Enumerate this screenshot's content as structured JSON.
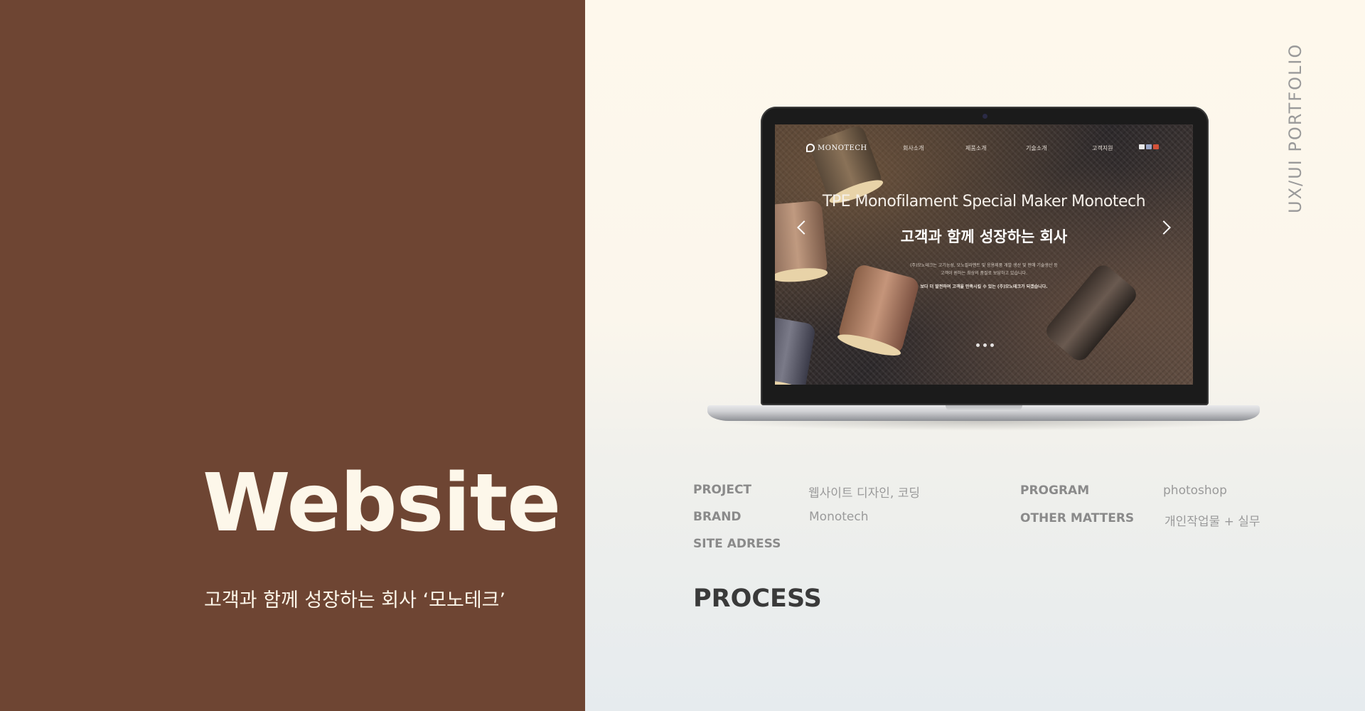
{
  "hero": {
    "title": "Website",
    "subtitle": "고객과 함께 성장하는 회사 ‘모노테크’"
  },
  "side_label": "UX/UI PORTFOLIO",
  "mockup": {
    "logo_text": "MONOTECH",
    "nav_items": [
      "회사소개",
      "제품소개",
      "기술소개",
      "고객지원"
    ],
    "heading": "TPE Monofilament Special Maker Monotech",
    "subheading": "고객과 함께 성장하는 회사",
    "description_lines": [
      "(주)모노테크는 고기능성, 모노필라멘트 및 응용제품 개발 생산 및 판매 기술생산 등",
      "고객이 원하는 최상의 품질로 보답하고 있습니다."
    ],
    "description_bold": "보다 더 발전하여 고객을 만족시킬 수 있는 (주)모노테크가 되겠습니다.",
    "slide_count": 3
  },
  "info": {
    "project_label": "PROJECT",
    "project_value": "웹사이트 디자인, 코딩",
    "brand_label": "BRAND",
    "brand_value": "Monotech",
    "site_label": "SITE ADRESS",
    "program_label": "PROGRAM",
    "program_value": "photoshop",
    "other_label": "OTHER MATTERS",
    "other_value": "개인작업물 + 실무"
  },
  "process_heading": "PROCESS",
  "colors": {
    "left_panel": "#6e4533",
    "cream": "#fdf7ea",
    "label_gray": "#8a8a8a"
  }
}
